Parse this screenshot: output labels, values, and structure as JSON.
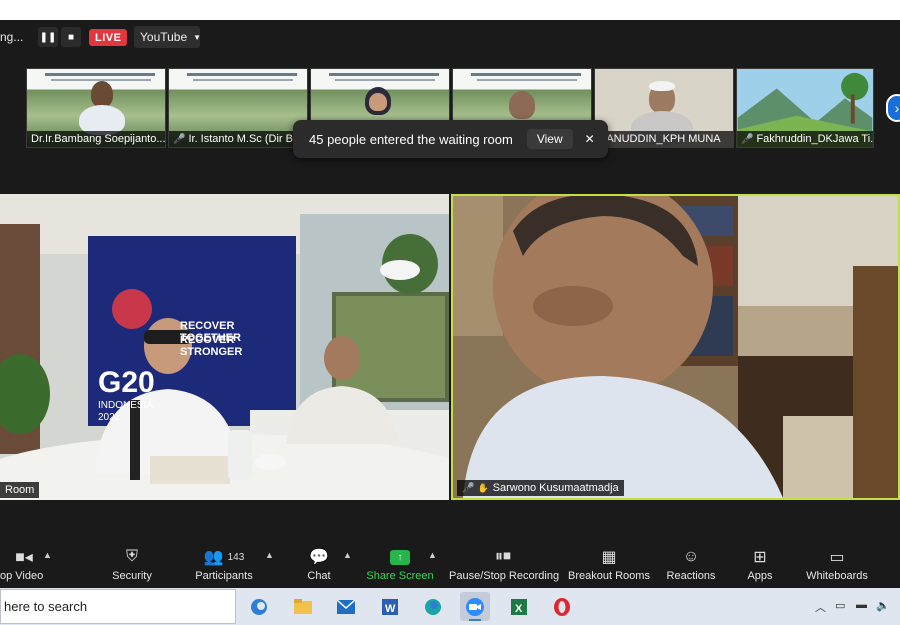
{
  "stream": {
    "meeting_name": "ng...",
    "live_label": "LIVE",
    "platform": "YouTube"
  },
  "thumbnails": [
    {
      "name": "Dr.Ir.Bambang Soepijanto...",
      "muted": false
    },
    {
      "name": "Ir. Istanto M.Sc (Dir BU...",
      "muted": true
    },
    {
      "name": "",
      "muted": false
    },
    {
      "name": "",
      "muted": false
    },
    {
      "name": "SANUDDIN_KPH MUNA",
      "muted": false
    },
    {
      "name": "Fakhruddin_DKJawa Ti...",
      "muted": true
    }
  ],
  "toast": {
    "message": "45 people entered the waiting room",
    "view_label": "View"
  },
  "main_videos": {
    "left_label": "Room",
    "banner_line1": "RECOVER TOGETHER",
    "banner_line2": "RECOVER STRONGER",
    "banner_logo": "G20",
    "banner_country": "INDONESIA",
    "banner_year": "2022",
    "right_label": "Sarwono Kusumaatmadja"
  },
  "toolbar": {
    "video": "op Video",
    "security": "Security",
    "participants": "Participants",
    "participants_count": "143",
    "chat": "Chat",
    "share_screen": "Share Screen",
    "recording": "Pause/Stop Recording",
    "breakout": "Breakout Rooms",
    "reactions": "Reactions",
    "apps": "Apps",
    "whiteboards": "Whiteboards"
  },
  "taskbar": {
    "search_text": "here to search",
    "apps": [
      "edge-beta",
      "file-explorer",
      "mail",
      "word",
      "edge",
      "zoom",
      "excel",
      "opera"
    ]
  },
  "colors": {
    "live": "#e0383e",
    "active_speaker": "#c4df43",
    "share": "#27b44a",
    "accent": "#1a6ed8"
  }
}
